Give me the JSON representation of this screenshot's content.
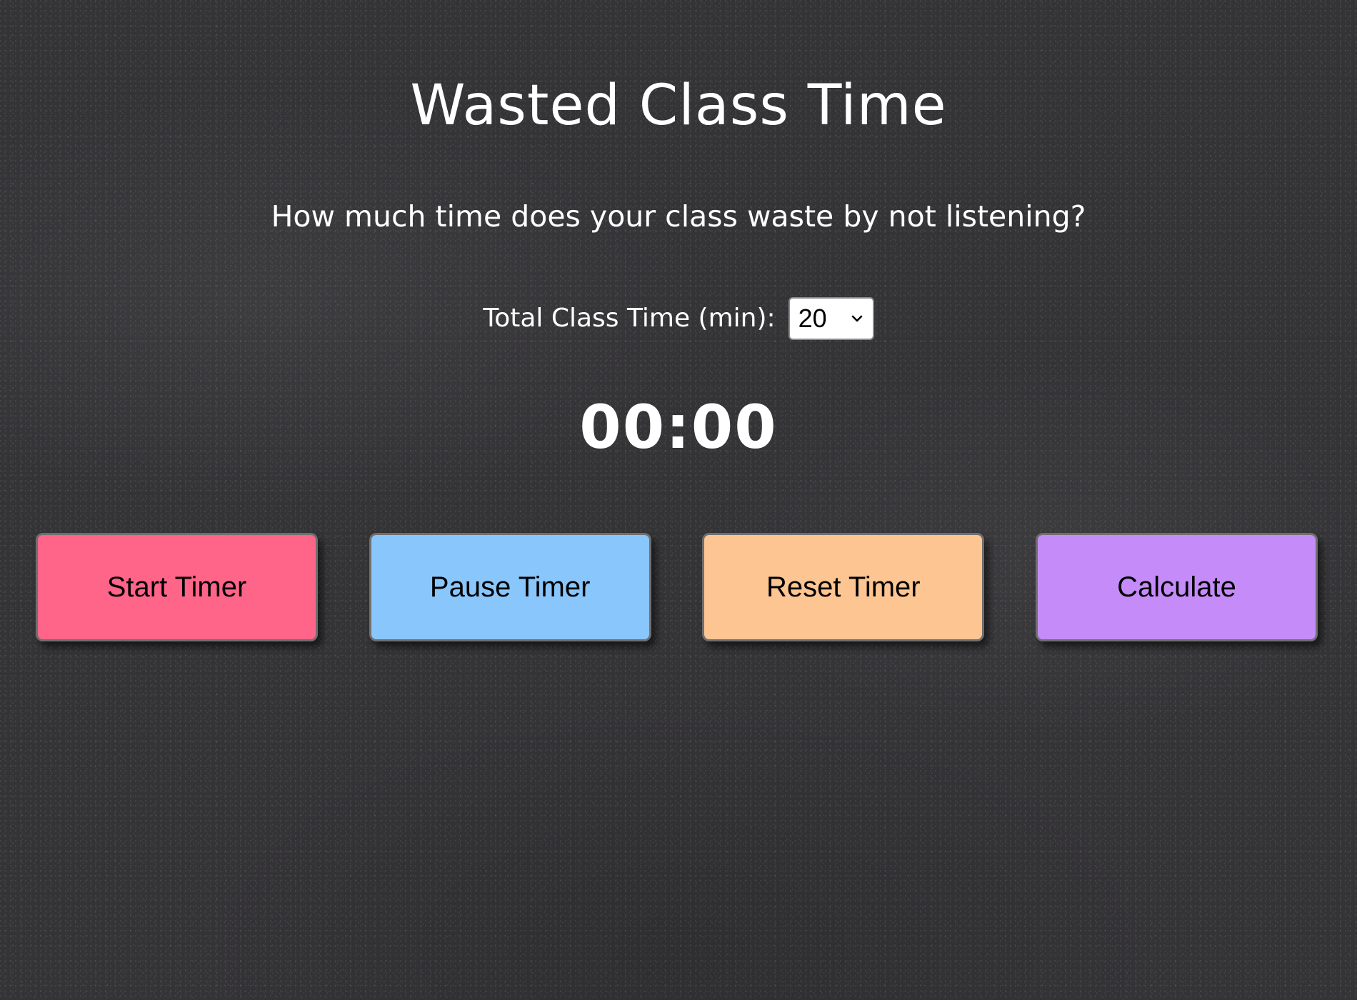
{
  "header": {
    "title": "Wasted Class Time",
    "subtitle": "How much time does your class waste by not listening?"
  },
  "class_time": {
    "label": "Total Class Time (min):",
    "selected_value": "20",
    "icon": "chevron-down-icon"
  },
  "timer": {
    "display": "00:00"
  },
  "buttons": [
    {
      "label": "Start Timer",
      "color": "#FF6489"
    },
    {
      "label": "Pause Timer",
      "color": "#89C6FB"
    },
    {
      "label": "Reset Timer",
      "color": "#FDC592"
    },
    {
      "label": "Calculate",
      "color": "#C58CF9"
    }
  ],
  "colors": {
    "background": "#343336",
    "text": "#FFFFFF"
  }
}
